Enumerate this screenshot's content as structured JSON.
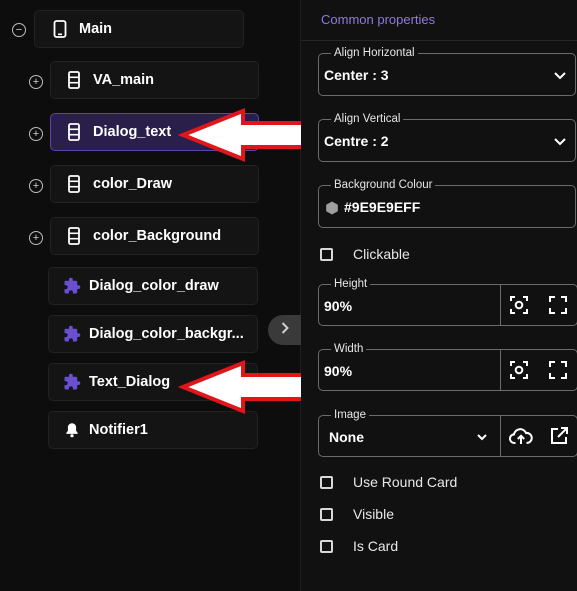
{
  "tree": {
    "root": {
      "label": "Main",
      "toggle": "−",
      "icon": "phone-icon"
    },
    "items": [
      {
        "label": "VA_main",
        "toggle": "+",
        "icon": "layout-rows-icon",
        "selected": false
      },
      {
        "label": "Dialog_text",
        "toggle": "+",
        "icon": "layout-rows-icon",
        "selected": true
      },
      {
        "label": "color_Draw",
        "toggle": "+",
        "icon": "layout-rows-icon",
        "selected": false
      },
      {
        "label": "color_Background",
        "toggle": "+",
        "icon": "layout-rows-icon",
        "selected": false
      },
      {
        "label": "Dialog_color_draw",
        "toggle": "",
        "icon": "puzzle-icon",
        "selected": false
      },
      {
        "label": "Dialog_color_backgr...",
        "toggle": "",
        "icon": "puzzle-icon",
        "selected": false
      },
      {
        "label": "Text_Dialog",
        "toggle": "",
        "icon": "puzzle-icon",
        "selected": false
      },
      {
        "label": "Notifier1",
        "toggle": "",
        "icon": "bell-icon",
        "selected": false
      }
    ],
    "collapse_icon": "chevron-right-icon"
  },
  "properties": {
    "section_title": "Common properties",
    "align_horizontal": {
      "label": "Align Horizontal",
      "value": "Center : 3"
    },
    "align_vertical": {
      "label": "Align Vertical",
      "value": "Centre : 2"
    },
    "background_colour": {
      "label": "Background Colour",
      "value": "#9E9E9EFF",
      "swatch": "#9e9e9e"
    },
    "clickable": {
      "label": "Clickable",
      "checked": false
    },
    "height": {
      "label": "Height",
      "value": "90%"
    },
    "width": {
      "label": "Width",
      "value": "90%"
    },
    "image": {
      "label": "Image",
      "value": "None"
    },
    "use_round_card": {
      "label": "Use Round Card",
      "checked": false
    },
    "visible": {
      "label": "Visible",
      "checked": false
    },
    "is_card": {
      "label": "Is Card",
      "checked": false
    }
  },
  "colors": {
    "accent": "#8f7be0",
    "selected_bg": "#2a1f4a",
    "arrow_red": "#e0161b"
  }
}
